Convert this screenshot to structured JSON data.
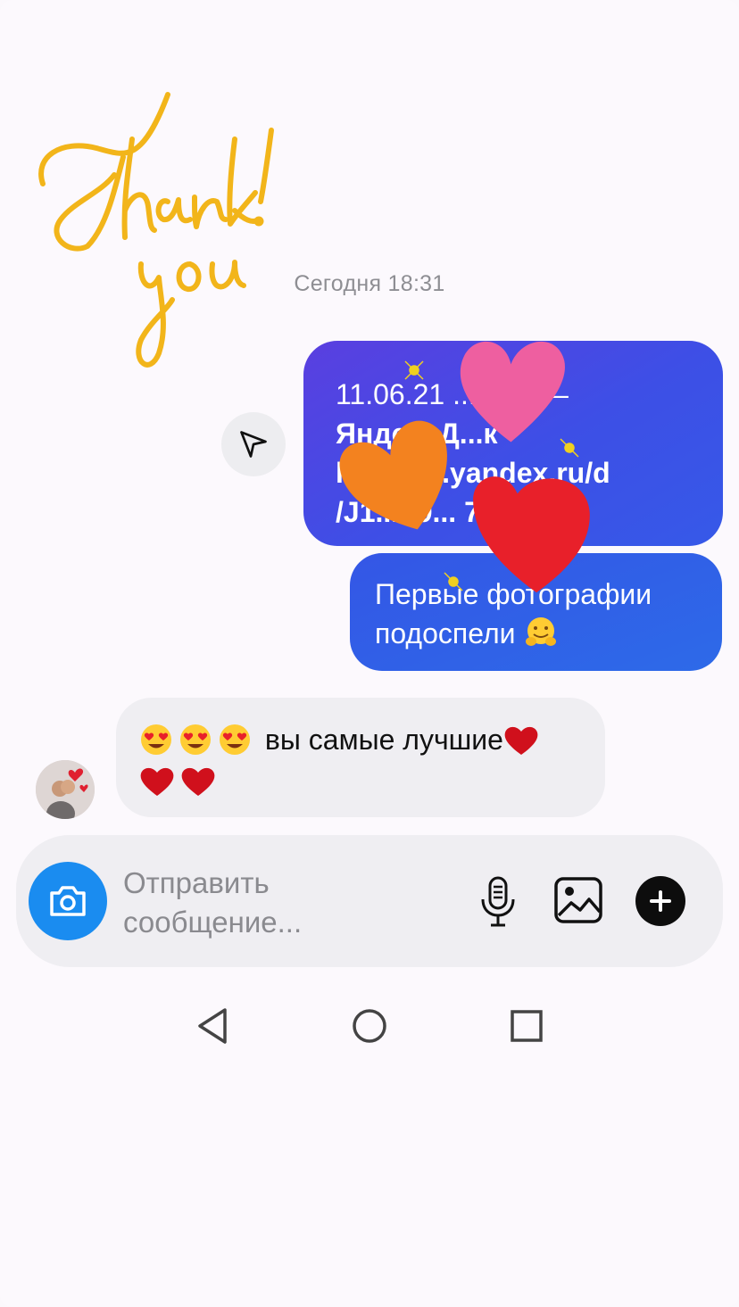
{
  "thank_you_sticker": "Thank you!",
  "chat": {
    "timestamp": "Сегодня 18:31",
    "messages_out": [
      {
        "line1": "11.06.21 ... ние —",
        "line2": "Янде... Д...к",
        "line3": "h... disk.yandex.ru/d",
        "line4": "/J1... t9... 7... A"
      },
      {
        "text": "Первые фотографии подоспели",
        "emoji": "hugging-face"
      }
    ],
    "message_in": {
      "text": "вы самые лучшие",
      "emojis_before": [
        "heart-eyes",
        "heart-eyes",
        "heart-eyes"
      ],
      "hearts_after": [
        "red-heart",
        "red-heart",
        "red-heart"
      ]
    }
  },
  "composer": {
    "placeholder": "Отправить сообщение..."
  },
  "colors": {
    "outgoing_bubble": "#3d4fe6",
    "outgoing_bubble_2": "#2d6ae8",
    "incoming_bubble": "#efeef2",
    "camera_button": "#1a8cf0",
    "sticker_yellow": "#f2b51a",
    "heart_pink": "#ee5fa0",
    "heart_orange": "#f3821f",
    "heart_red": "#e8202a"
  },
  "icons": {
    "share": "paper-plane-icon",
    "camera": "camera-icon",
    "mic": "microphone-icon",
    "gallery": "image-icon",
    "add": "plus-icon",
    "nav_back": "triangle-back-icon",
    "nav_home": "circle-home-icon",
    "nav_recent": "square-recents-icon"
  }
}
